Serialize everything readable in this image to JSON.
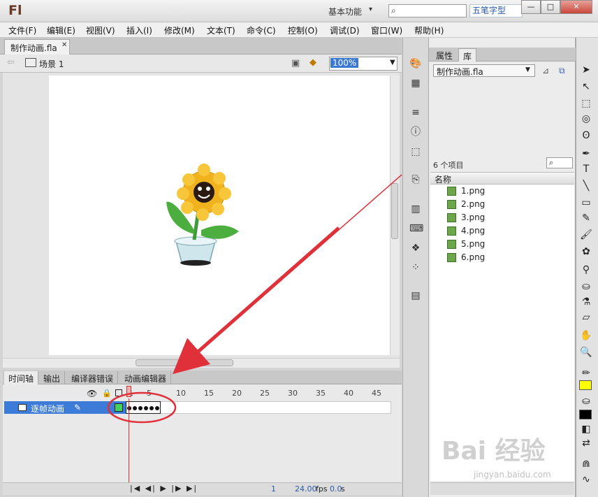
{
  "titlebar": {
    "app_logo": "Fl",
    "workspace": "基本功能",
    "ime_text": "五笔字型"
  },
  "menubar": {
    "items": [
      {
        "label": "文件(F)"
      },
      {
        "label": "编辑(E)"
      },
      {
        "label": "视图(V)"
      },
      {
        "label": "插入(I)"
      },
      {
        "label": "修改(M)"
      },
      {
        "label": "文本(T)"
      },
      {
        "label": "命令(C)"
      },
      {
        "label": "控制(O)"
      },
      {
        "label": "调试(D)"
      },
      {
        "label": "窗口(W)"
      },
      {
        "label": "帮助(H)"
      }
    ]
  },
  "document": {
    "tab_label": "制作动画.fla",
    "scene": "场景 1",
    "zoom": "100%"
  },
  "bottom_tabs": [
    "时间轴",
    "输出",
    "编译器错误",
    "动画编辑器"
  ],
  "timeline": {
    "frame_numbers": [
      "1",
      "5",
      "10",
      "15",
      "20",
      "25",
      "30",
      "35",
      "40",
      "45"
    ],
    "layer_name": "逐帧动画",
    "keyframe_count": 6,
    "status": {
      "current_frame": "1",
      "fps": "24.00",
      "fps_unit": "fps",
      "elapsed": "0.0",
      "elapsed_unit": "s"
    }
  },
  "library": {
    "tabs": [
      "属性",
      "库"
    ],
    "document": "制作动画.fla",
    "item_count": "6 个项目",
    "column_name": "名称",
    "items": [
      "1.png",
      "2.png",
      "3.png",
      "4.png",
      "5.png",
      "6.png"
    ]
  },
  "colors": {
    "stroke": "#ffff00",
    "fill": "#000000",
    "annotation": "#e0303a",
    "selection": "#3d7bd8"
  },
  "watermark": {
    "text": "Bai 经验",
    "sub": "jingyan.baidu.com"
  }
}
